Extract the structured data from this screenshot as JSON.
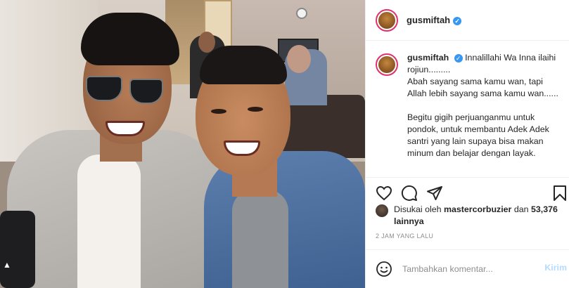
{
  "post": {
    "username": "gusmiftah",
    "verified_icon": "verified-badge-icon",
    "caption_lines": [
      "Innalillahi Wa Inna ilaihi rojiun.........",
      "Abah sayang sama kamu wan, tapi Allah lebih sayang sama kamu wan......"
    ],
    "caption_para2": "Begitu gigih perjuanganmu untuk pondok, untuk membantu Adek Adek santri yang lain supaya bisa makan minum dan belajar dengan layak.",
    "likes_prefix": "Disukai oleh",
    "liked_by": "mastercorbuzier",
    "likes_and": "dan",
    "likes_count": "53,376 lainnya",
    "timestamp": "2 JAM YANG LALU",
    "comment_placeholder": "Tambahkan komentar...",
    "post_button": "Kirim"
  },
  "icons": {
    "like": "heart-icon",
    "comment": "comment-icon",
    "share": "share-icon",
    "save": "bookmark-icon",
    "emoji": "emoji-icon"
  },
  "colors": {
    "accent": "#3897f0",
    "post_disabled": "#b3dbff",
    "muted": "#8e8e8e"
  }
}
